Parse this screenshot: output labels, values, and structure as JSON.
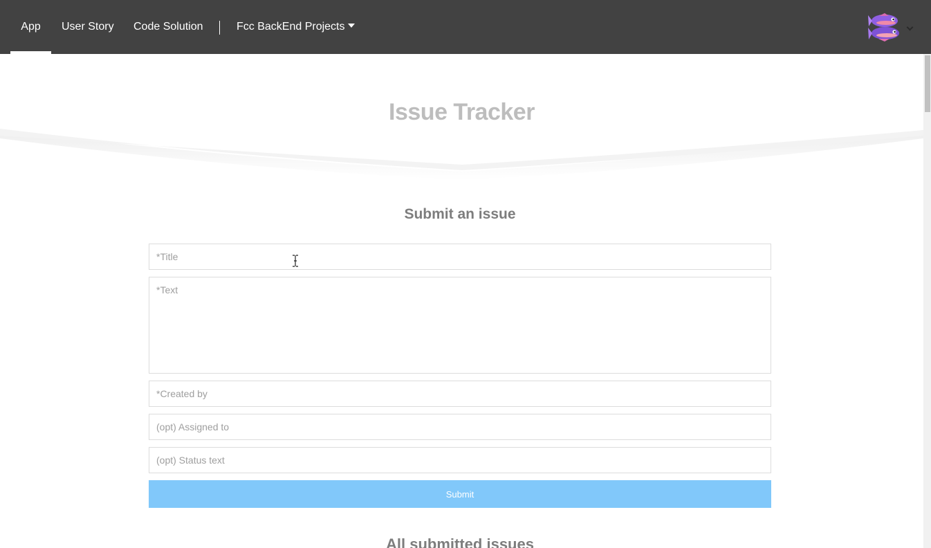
{
  "nav": {
    "items": [
      {
        "label": "App",
        "active": true
      },
      {
        "label": "User Story",
        "active": false
      },
      {
        "label": "Code Solution",
        "active": false
      }
    ],
    "projects_label": "Fcc BackEnd Projects",
    "dropdown_icon": "caret-down-icon",
    "avatar_icon": "fish-avatar-icon",
    "background_color": "#424242"
  },
  "page": {
    "title": "Issue Tracker"
  },
  "form": {
    "heading": "Submit an issue",
    "title_placeholder": "*Title",
    "text_placeholder": "*Text",
    "created_by_placeholder": "*Created by",
    "assigned_to_placeholder": "(opt) Assigned to",
    "status_text_placeholder": "(opt) Status text",
    "submit_label": "Submit",
    "submit_color": "#81c8fa"
  },
  "issues": {
    "heading": "All submitted issues"
  }
}
